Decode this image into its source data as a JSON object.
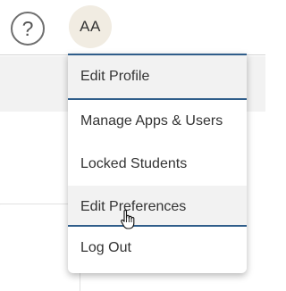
{
  "header": {
    "help_glyph": "?",
    "avatar_initials": "AA"
  },
  "user_menu": {
    "items": [
      {
        "label": "Edit Profile"
      },
      {
        "label": "Manage Apps & Users"
      },
      {
        "label": "Locked Students"
      },
      {
        "label": "Edit Preferences"
      },
      {
        "label": "Log Out"
      }
    ],
    "hovered_item": "Edit Preferences"
  },
  "colors": {
    "accent_rule": "#2f5d8a",
    "avatar_bg": "#f1ece2",
    "hover_bg": "#f2f2f2"
  },
  "icons": [
    "help-icon",
    "hand-pointer-cursor-icon"
  ]
}
